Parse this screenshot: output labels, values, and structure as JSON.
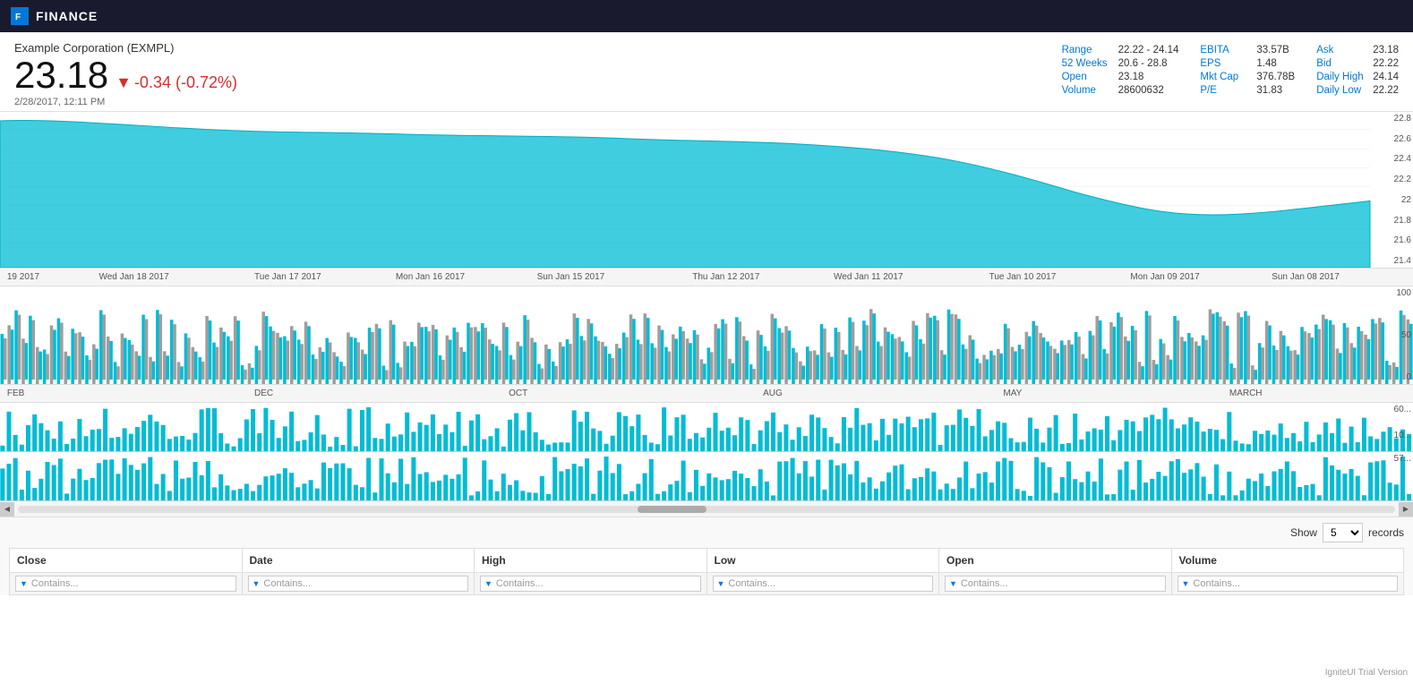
{
  "app": {
    "title": "FINANCE",
    "logo_text": "F"
  },
  "stock": {
    "name": "Example Corporation (EXMPL)",
    "price": "23.18",
    "change": "-0.34 (-0.72%)",
    "date": "2/28/2017, 12:11 PM"
  },
  "stats": {
    "col1": [
      {
        "label": "Range",
        "value": "22.22 - 24.14"
      },
      {
        "label": "52 Weeks",
        "value": "20.6 - 28.8"
      },
      {
        "label": "Open",
        "value": "23.18"
      },
      {
        "label": "Volume",
        "value": "28600632"
      }
    ],
    "col2": [
      {
        "label": "EBITA",
        "value": "33.57B"
      },
      {
        "label": "EPS",
        "value": "1.48"
      },
      {
        "label": "Mkt Cap",
        "value": "376.78B"
      },
      {
        "label": "P/E",
        "value": "31.83"
      }
    ],
    "col3": [
      {
        "label": "Ask",
        "value": "23.18"
      },
      {
        "label": "Bid",
        "value": "22.22"
      },
      {
        "label": "Daily High",
        "value": "24.14"
      },
      {
        "label": "Daily Low",
        "value": "22.22"
      }
    ]
  },
  "chart": {
    "y_axis": [
      "22.8",
      "22.6",
      "22.4",
      "22.2",
      "22",
      "21.8",
      "21.6",
      "21.4"
    ]
  },
  "date_labels": [
    {
      "text": "19 2017",
      "left_pct": "0%"
    },
    {
      "text": "Wed Jan 18 2017",
      "left_pct": "7%"
    },
    {
      "text": "Tue Jan 17 2017",
      "left_pct": "18%"
    },
    {
      "text": "Mon Jan 16 2017",
      "left_pct": "28%"
    },
    {
      "text": "Sun Jan 15 2017",
      "left_pct": "38%"
    },
    {
      "text": "Thu Jan 12 2017",
      "left_pct": "49%"
    },
    {
      "text": "Wed Jan 11 2017",
      "left_pct": "60%"
    },
    {
      "text": "Tue Jan 10 2017",
      "left_pct": "71%"
    },
    {
      "text": "Mon Jan 09 2017",
      "left_pct": "81%"
    },
    {
      "text": "Sun Jan 08 2017",
      "left_pct": "91%"
    }
  ],
  "candle_axis": [
    "100",
    "50",
    "0"
  ],
  "month_labels": [
    {
      "text": "FEB",
      "left_pct": "0%"
    },
    {
      "text": "DEC",
      "left_pct": "18%"
    },
    {
      "text": "OCT",
      "left_pct": "36%"
    },
    {
      "text": "AUG",
      "left_pct": "54%"
    },
    {
      "text": "MAY",
      "left_pct": "71%"
    },
    {
      "text": "MARCH",
      "left_pct": "87%"
    }
  ],
  "volume_axis": [
    "60...",
    "10..."
  ],
  "table": {
    "show_label": "Show",
    "records_label": "records",
    "records_value": "5",
    "columns": [
      "Close",
      "Date",
      "High",
      "Low",
      "Open",
      "Volume"
    ],
    "filter_placeholder": "Contains...",
    "filter_icon": "▼"
  },
  "ignite": "IgniteUI Trial Version"
}
